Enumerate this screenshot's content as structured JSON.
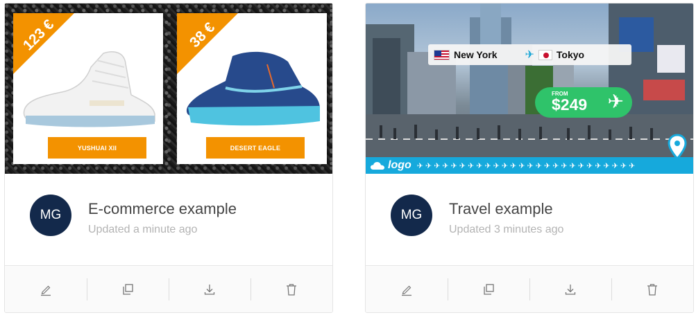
{
  "cards": [
    {
      "title": "E-commerce example",
      "updated": "Updated a minute ago",
      "avatar": "MG",
      "products": [
        {
          "price": "123 €",
          "name": "YUSHUAI XII"
        },
        {
          "price": "38 €",
          "name": "DESERT EAGLE"
        }
      ]
    },
    {
      "title": "Travel example",
      "updated": "Updated 3 minutes ago",
      "avatar": "MG",
      "route": {
        "from": "New York",
        "to": "Tokyo"
      },
      "price": {
        "label": "FROM",
        "amount": "$249"
      },
      "logo": "logo"
    }
  ],
  "toolbar_icons": [
    "edit-icon",
    "duplicate-icon",
    "download-icon",
    "delete-icon"
  ],
  "colors": {
    "accent_orange": "#f39200",
    "avatar_bg": "#13294b",
    "travel_blue": "#16a9dc",
    "price_green": "#2fc36a"
  }
}
